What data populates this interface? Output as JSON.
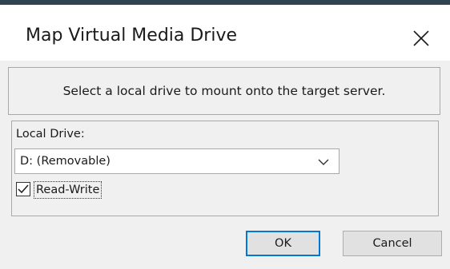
{
  "dialog": {
    "title": "Map Virtual Media Drive",
    "description": "Select a local drive to mount onto the target server.",
    "local_drive_label": "Local Drive:",
    "local_drive_value": "D: (Removable)",
    "read_write_label": "Read-Write",
    "read_write_checked": true,
    "ok_label": "OK",
    "cancel_label": "Cancel"
  },
  "icons": {
    "close": "close-icon",
    "dropdown": "chevron-down-icon",
    "check": "checkmark-icon"
  },
  "colors": {
    "title_strip": "#2f4450",
    "client_bg": "#f0f0f0",
    "default_button_border": "#0078d7"
  }
}
